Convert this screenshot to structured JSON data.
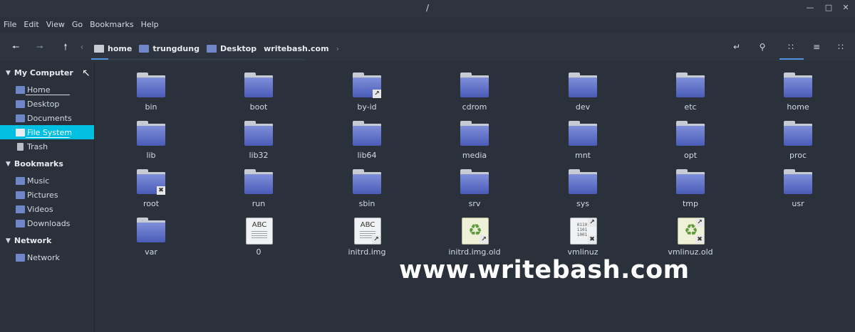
{
  "window": {
    "title": "/",
    "controls": [
      "minimize-icon",
      "maximize-icon",
      "close-icon"
    ]
  },
  "menu": [
    "File",
    "Edit",
    "View",
    "Go",
    "Bookmarks",
    "Help"
  ],
  "breadcrumb": [
    "home",
    "trungdung",
    "Desktop",
    "writebash.com"
  ],
  "sidebar": {
    "sections": [
      {
        "title": "My Computer",
        "items": [
          "Home",
          "Desktop",
          "Documents",
          "File System",
          "Trash"
        ]
      },
      {
        "title": "Bookmarks",
        "items": [
          "Music",
          "Pictures",
          "Videos",
          "Downloads"
        ]
      },
      {
        "title": "Network",
        "items": [
          "Network"
        ]
      }
    ],
    "active_item": "File System"
  },
  "files": [
    "bin",
    "boot",
    "by-id",
    "cdrom",
    "dev",
    "etc",
    "home",
    "lib",
    "lib32",
    "lib64",
    "media",
    "mnt",
    "opt",
    "proc",
    "root",
    "run",
    "sbin",
    "srv",
    "sys",
    "tmp",
    "usr",
    "var",
    "0",
    "initrd.img",
    "initrd.img.old",
    "vmlinuz",
    "vmlinuz.old"
  ],
  "doc_glyph": "ABC",
  "watermark": "www.writebash.com",
  "colors": {
    "accent": "#00bfe0",
    "folder": "#5a6ac4",
    "background": "#2b313a"
  }
}
